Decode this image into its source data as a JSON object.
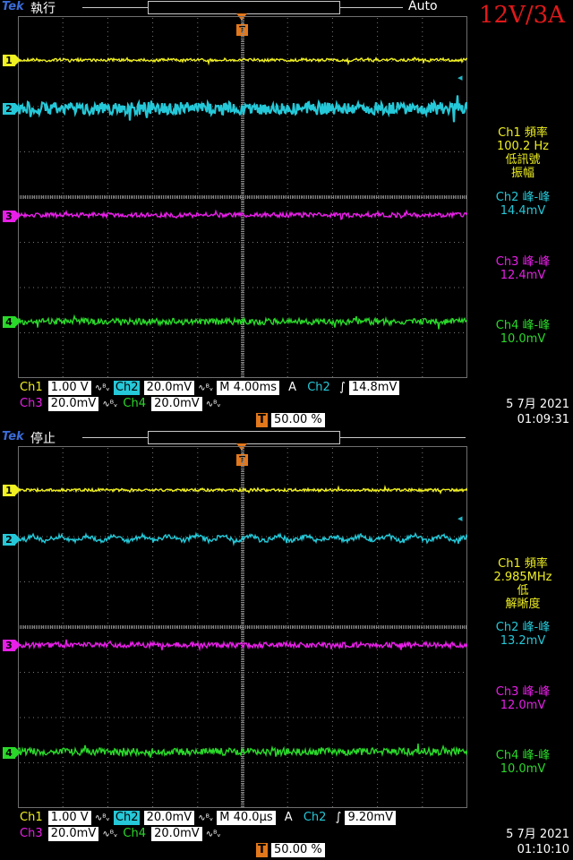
{
  "spec_label": "12V/3A",
  "colors": {
    "ch1": "#f0f022",
    "ch2": "#25c8d8",
    "ch3": "#e81fe8",
    "ch4": "#2ad82a",
    "trigger": "#e3771b",
    "spec": "#e1191a"
  },
  "panels": [
    {
      "brand": "Tek",
      "status": "執行",
      "trigger_mode": "Auto",
      "channels": [
        {
          "id": "1",
          "label": "1",
          "amp": 1.2,
          "noise": 1.5
        },
        {
          "id": "2",
          "label": "2",
          "amp": 0,
          "noise": 7
        },
        {
          "id": "3",
          "label": "3",
          "amp": 0,
          "noise": 2.5
        },
        {
          "id": "4",
          "label": "4",
          "amp": 0,
          "noise": 3.5
        }
      ],
      "readouts": {
        "ch1_title": "Ch1 頻率",
        "ch1_value": "100.2 Hz",
        "ch1_note1": "低訊號",
        "ch1_note2": "振幅",
        "ch2_title": "Ch2 峰-峰",
        "ch2_value": "14.4mV",
        "ch3_title": "Ch3 峰-峰",
        "ch3_value": "12.4mV",
        "ch4_title": "Ch4 峰-峰",
        "ch4_value": "10.0mV"
      },
      "footer": {
        "ch1": "Ch1",
        "ch1_scale": "1.00 V",
        "ch2": "Ch2",
        "ch2_scale": "20.0mV",
        "ch3": "Ch3",
        "ch3_scale": "20.0mV",
        "ch4": "Ch4",
        "ch4_scale": "20.0mV",
        "coupling": "∿ᴮᵥ",
        "timebase": "M 4.00ms",
        "acq": "A",
        "trig_src": "Ch2",
        "trig_slope": "∫",
        "trig_level": "14.8mV",
        "position": "50.00 %",
        "date": "5 7月  2021",
        "time": "01:09:31"
      },
      "ripple": 0
    },
    {
      "brand": "Tek",
      "status": "停止",
      "trigger_mode": "",
      "channels": [
        {
          "id": "1",
          "label": "1",
          "amp": 0,
          "noise": 1.5
        },
        {
          "id": "2",
          "label": "2",
          "amp": 6,
          "noise": 2.5
        },
        {
          "id": "3",
          "label": "3",
          "amp": 0,
          "noise": 3
        },
        {
          "id": "4",
          "label": "4",
          "amp": 0,
          "noise": 4
        }
      ],
      "readouts": {
        "ch1_title": "Ch1 頻率",
        "ch1_value": "2.985MHz",
        "ch1_note1": "低",
        "ch1_note2": "解晰度",
        "ch2_title": "Ch2 峰-峰",
        "ch2_value": "13.2mV",
        "ch3_title": "Ch3 峰-峰",
        "ch3_value": "12.0mV",
        "ch4_title": "Ch4 峰-峰",
        "ch4_value": "10.0mV"
      },
      "footer": {
        "ch1": "Ch1",
        "ch1_scale": "1.00 V",
        "ch2": "Ch2",
        "ch2_scale": "20.0mV",
        "ch3": "Ch3",
        "ch3_scale": "20.0mV",
        "ch4": "Ch4",
        "ch4_scale": "20.0mV",
        "coupling": "∿ᴮᵥ",
        "timebase": "M 40.0µs",
        "acq": "A",
        "trig_src": "Ch2",
        "trig_slope": "∫",
        "trig_level": "9.20mV",
        "position": "50.00 %",
        "date": "5 7月  2021",
        "time": "01:10:10"
      },
      "ripple": 1
    }
  ]
}
